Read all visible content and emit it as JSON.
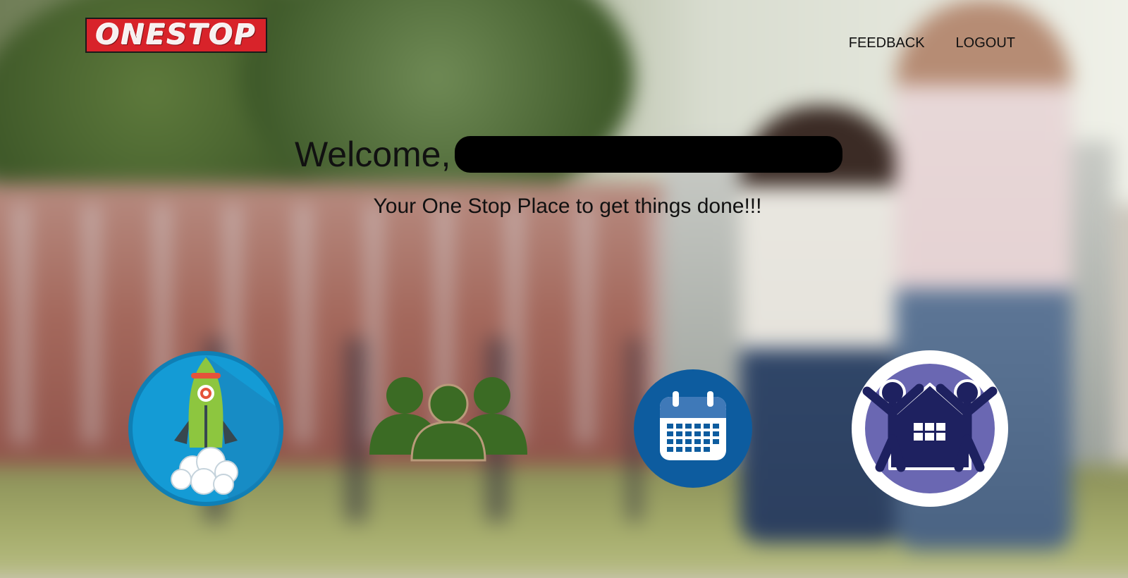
{
  "header": {
    "logo_text": "ONESTOP",
    "nav": [
      {
        "label": "FEEDBACK"
      },
      {
        "label": "LOGOUT"
      }
    ]
  },
  "hero": {
    "welcome": "Welcome,",
    "tagline": "Your One Stop Place to get things done!!!"
  },
  "tiles": [
    {
      "icon": "rocket-icon"
    },
    {
      "icon": "group-icon"
    },
    {
      "icon": "calendar-icon"
    },
    {
      "icon": "family-home-icon"
    }
  ],
  "colors": {
    "logo_red": "#d8232a",
    "rocket_blue": "#149bd5",
    "group_green": "#3b6b24",
    "calendar_blue": "#0d5c9f",
    "family_purple": "#6a67b2"
  }
}
